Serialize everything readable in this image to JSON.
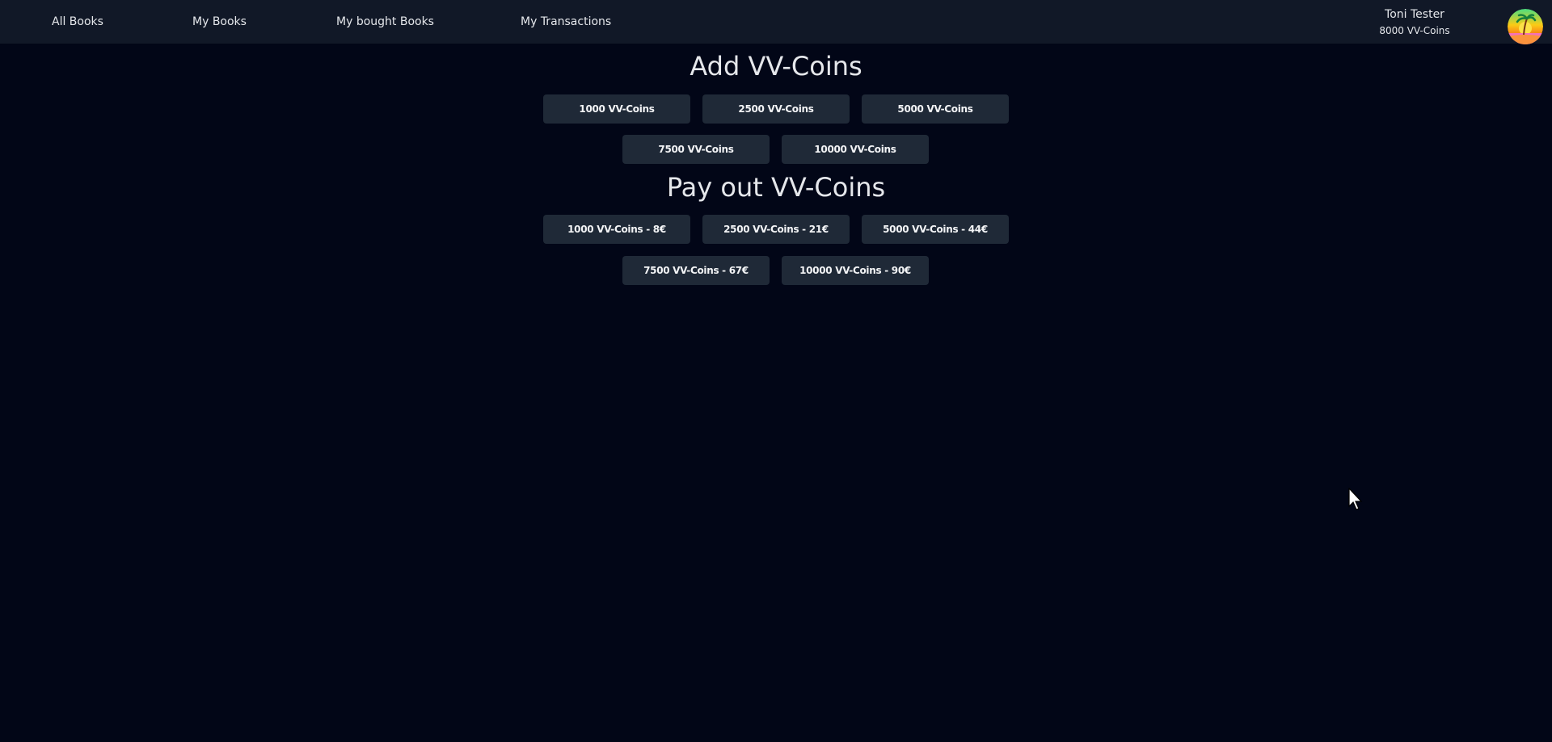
{
  "nav": {
    "links": [
      "All Books",
      "My Books",
      "My bought Books",
      "My Transactions"
    ]
  },
  "user": {
    "name": "Toni Tester",
    "coins": "8000 VV-Coins",
    "avatar_icon": "palm-beach-sunset-avatar"
  },
  "add_section": {
    "title": "Add VV-Coins",
    "options": [
      "1000 VV-Coins",
      "2500 VV-Coins",
      "5000 VV-Coins",
      "7500 VV-Coins",
      "10000 VV-Coins"
    ]
  },
  "payout_section": {
    "title": "Pay out VV-Coins",
    "options": [
      "1000 VV-Coins - 8€",
      "2500 VV-Coins - 21€",
      "5000 VV-Coins - 44€",
      "7500 VV-Coins - 67€",
      "10000 VV-Coins - 90€"
    ]
  },
  "colors": {
    "background": "#020617",
    "navbar": "#111827",
    "button": "#1f2937",
    "text": "#e5e7eb"
  }
}
